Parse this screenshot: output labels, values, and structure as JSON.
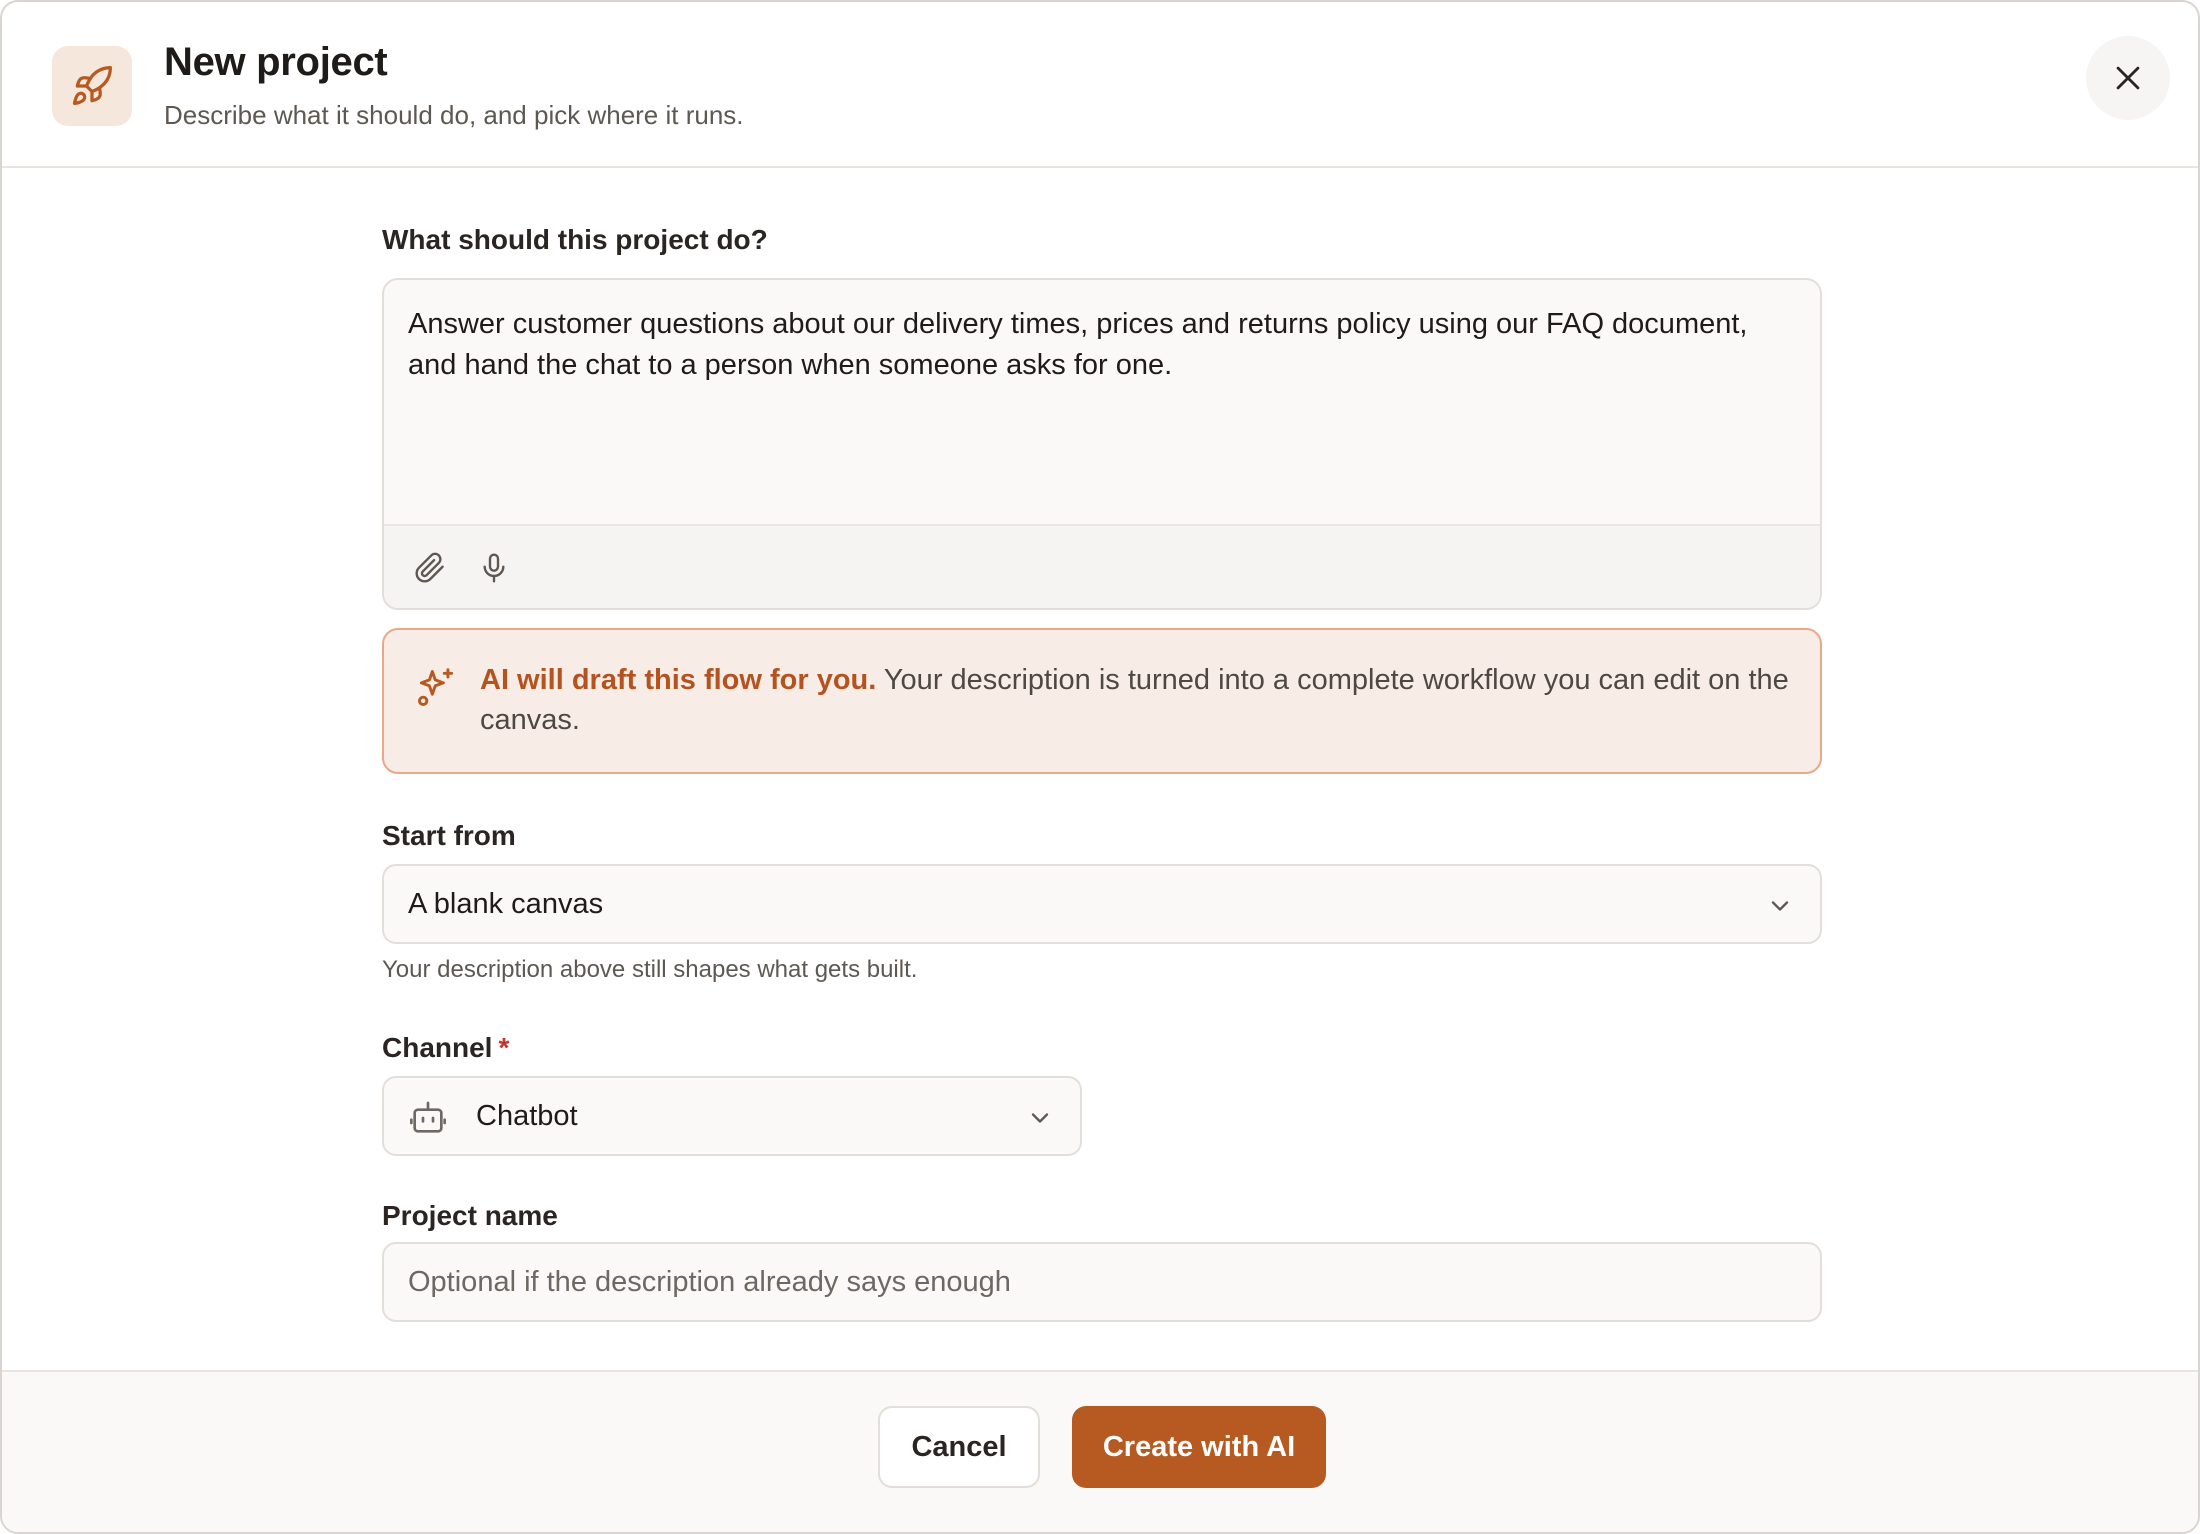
{
  "header": {
    "title": "New project",
    "subtitle": "Describe what it should do, and pick where it runs.",
    "icon": "rocket-icon",
    "close_icon": "close-icon"
  },
  "description": {
    "label": "What should this project do?",
    "value": "Answer customer questions about our delivery times, prices and returns policy using our FAQ document, and hand the chat to a person when someone asks for one.",
    "toolbar_icons": [
      "paperclip-icon",
      "microphone-icon"
    ]
  },
  "ai_callout": {
    "icon": "sparkles-icon",
    "strong": "AI will draft this flow for you.",
    "text": " Your description is turned into a complete workflow you can edit on the canvas."
  },
  "start_from": {
    "label": "Start from",
    "value": "A blank canvas",
    "hint": "Your description above still shapes what gets built."
  },
  "channel": {
    "label": "Channel",
    "required_mark": "*",
    "value": "Chatbot",
    "icon": "robot-icon"
  },
  "project_name": {
    "label": "Project name",
    "placeholder": "Optional if the description already says enough"
  },
  "footer": {
    "cancel_label": "Cancel",
    "create_label": "Create with AI"
  },
  "colors": {
    "accent": "#b65a22",
    "accent_text": "#b4531f",
    "callout_bg": "#f8ece6",
    "callout_border": "#e8a88a",
    "required": "#c4342c"
  }
}
